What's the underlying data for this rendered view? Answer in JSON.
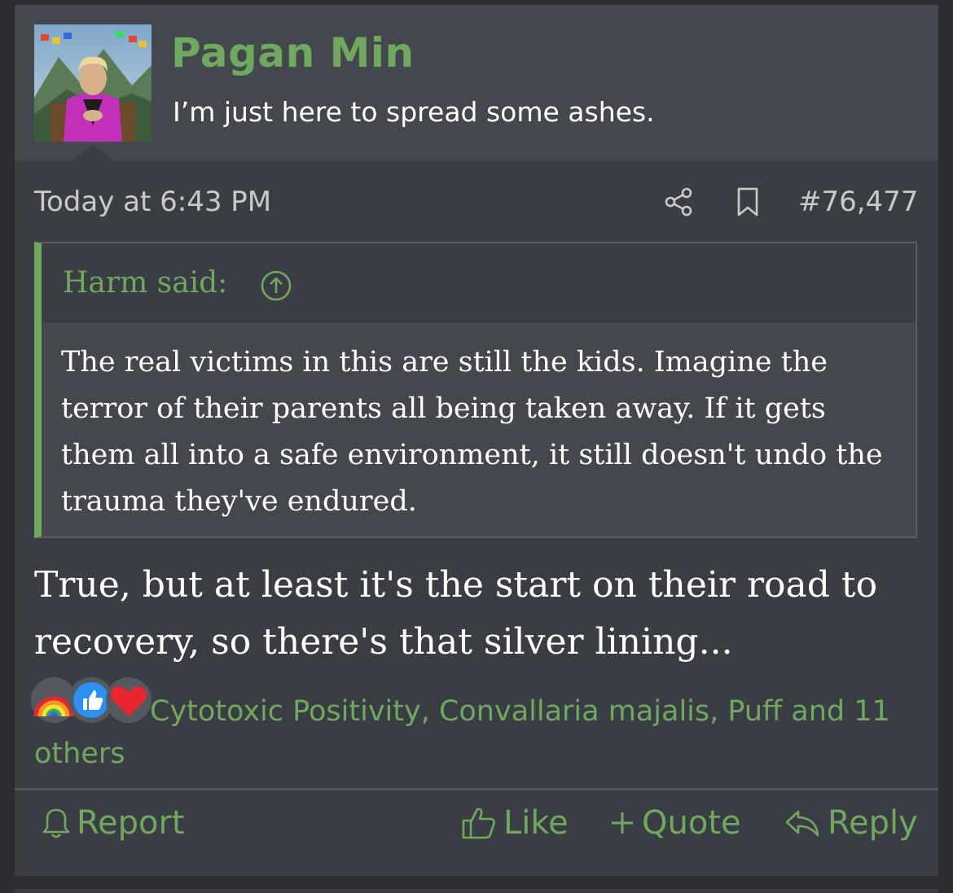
{
  "post": {
    "username": "Pagan Min",
    "user_title": "I’m just here to spread some ashes.",
    "timestamp": "Today at 6:43 PM",
    "post_number": "#76,477"
  },
  "quote": {
    "author": "Harm said:",
    "text": "The real victims in this are still the kids. Imagine the terror of their parents all being taken away. If it gets them all into a safe environment, it still doesn't undo the trauma they've endured."
  },
  "message": "True, but at least it's the start on their road to recovery, so there's that silver lining...",
  "reactions": {
    "icons": [
      "rainbow-reaction",
      "like-reaction",
      "heart-reaction"
    ],
    "text": "Cytotoxic Positivity, Convallaria majalis, Puff and 11 others"
  },
  "actions": {
    "report": "Report",
    "like": "Like",
    "quote": "Quote",
    "reply": "Reply"
  },
  "colors": {
    "accent": "#6fa85e",
    "card": "#3a3d43",
    "header": "#44474e",
    "like_blue": "#2d8ff0",
    "heart_red": "#e8262f"
  }
}
